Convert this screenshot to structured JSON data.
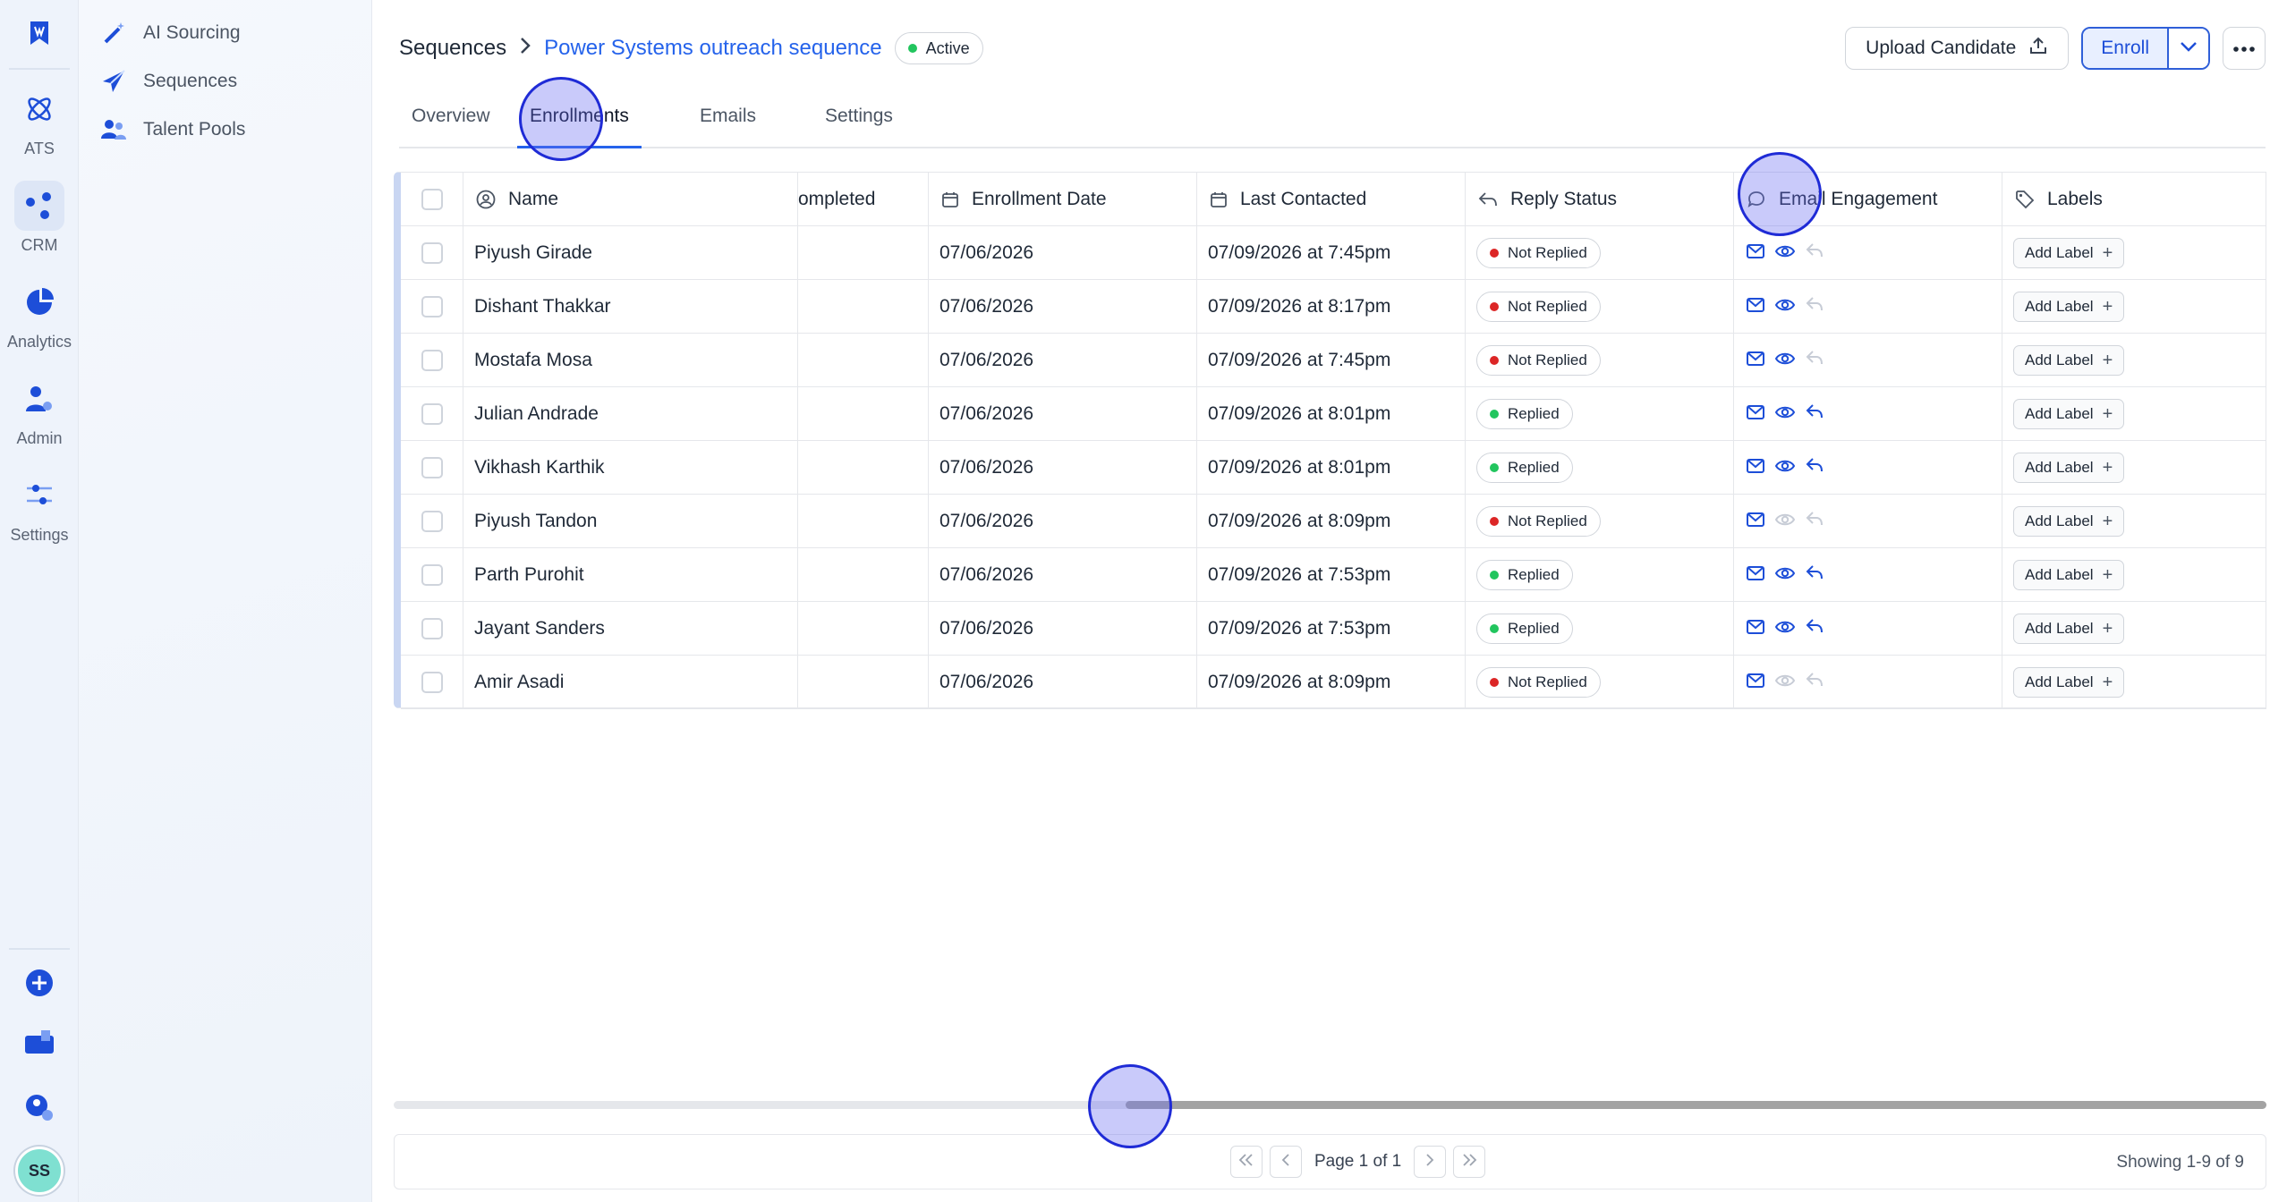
{
  "rail": {
    "items": [
      {
        "label": "ATS"
      },
      {
        "label": "CRM"
      },
      {
        "label": "Analytics"
      },
      {
        "label": "Admin"
      },
      {
        "label": "Settings"
      }
    ],
    "avatar_initials": "SS"
  },
  "subnav": {
    "items": [
      {
        "label": "AI Sourcing",
        "icon": "wand-icon"
      },
      {
        "label": "Sequences",
        "icon": "paper-plane-icon"
      },
      {
        "label": "Talent Pools",
        "icon": "users-icon"
      }
    ]
  },
  "header": {
    "breadcrumb_root": "Sequences",
    "sequence_name": "Power Systems outreach sequence",
    "status": "Active",
    "upload_label": "Upload Candidate",
    "enroll_label": "Enroll"
  },
  "tabs": [
    {
      "label": "Overview"
    },
    {
      "label": "Enrollments",
      "active": true
    },
    {
      "label": "Emails"
    },
    {
      "label": "Settings"
    }
  ],
  "table": {
    "columns": {
      "name": "Name",
      "completed": "ompleted",
      "enrollment_date": "Enrollment Date",
      "last_contacted": "Last Contacted",
      "reply_status": "Reply Status",
      "email_engagement": "Email Engagement",
      "labels": "Labels"
    },
    "add_label_text": "Add Label",
    "rows": [
      {
        "name": "Piyush Girade",
        "enrolled": "07/06/2026",
        "last": "07/09/2026 at 7:45pm",
        "reply": "Not Replied",
        "opened": true,
        "replied": false
      },
      {
        "name": "Dishant Thakkar",
        "enrolled": "07/06/2026",
        "last": "07/09/2026 at 8:17pm",
        "reply": "Not Replied",
        "opened": true,
        "replied": false
      },
      {
        "name": "Mostafa Mosa",
        "enrolled": "07/06/2026",
        "last": "07/09/2026 at 7:45pm",
        "reply": "Not Replied",
        "opened": true,
        "replied": false
      },
      {
        "name": "Julian Andrade",
        "enrolled": "07/06/2026",
        "last": "07/09/2026 at 8:01pm",
        "reply": "Replied",
        "opened": true,
        "replied": true
      },
      {
        "name": "Vikhash Karthik",
        "enrolled": "07/06/2026",
        "last": "07/09/2026 at 8:01pm",
        "reply": "Replied",
        "opened": true,
        "replied": true
      },
      {
        "name": "Piyush Tandon",
        "enrolled": "07/06/2026",
        "last": "07/09/2026 at 8:09pm",
        "reply": "Not Replied",
        "opened": false,
        "replied": false
      },
      {
        "name": "Parth Purohit",
        "enrolled": "07/06/2026",
        "last": "07/09/2026 at 7:53pm",
        "reply": "Replied",
        "opened": true,
        "replied": true
      },
      {
        "name": "Jayant Sanders",
        "enrolled": "07/06/2026",
        "last": "07/09/2026 at 7:53pm",
        "reply": "Replied",
        "opened": true,
        "replied": true
      },
      {
        "name": "Amir Asadi",
        "enrolled": "07/06/2026",
        "last": "07/09/2026 at 8:09pm",
        "reply": "Not Replied",
        "opened": false,
        "replied": false
      }
    ]
  },
  "footer": {
    "page_text": "Page 1 of 1",
    "showing_text": "Showing 1-9 of 9"
  },
  "colors": {
    "accent": "#2563eb",
    "replied": "#22c55e",
    "not_replied": "#dc2626",
    "icon_active": "#1d4ed8",
    "icon_muted": "#c7ccd6"
  }
}
